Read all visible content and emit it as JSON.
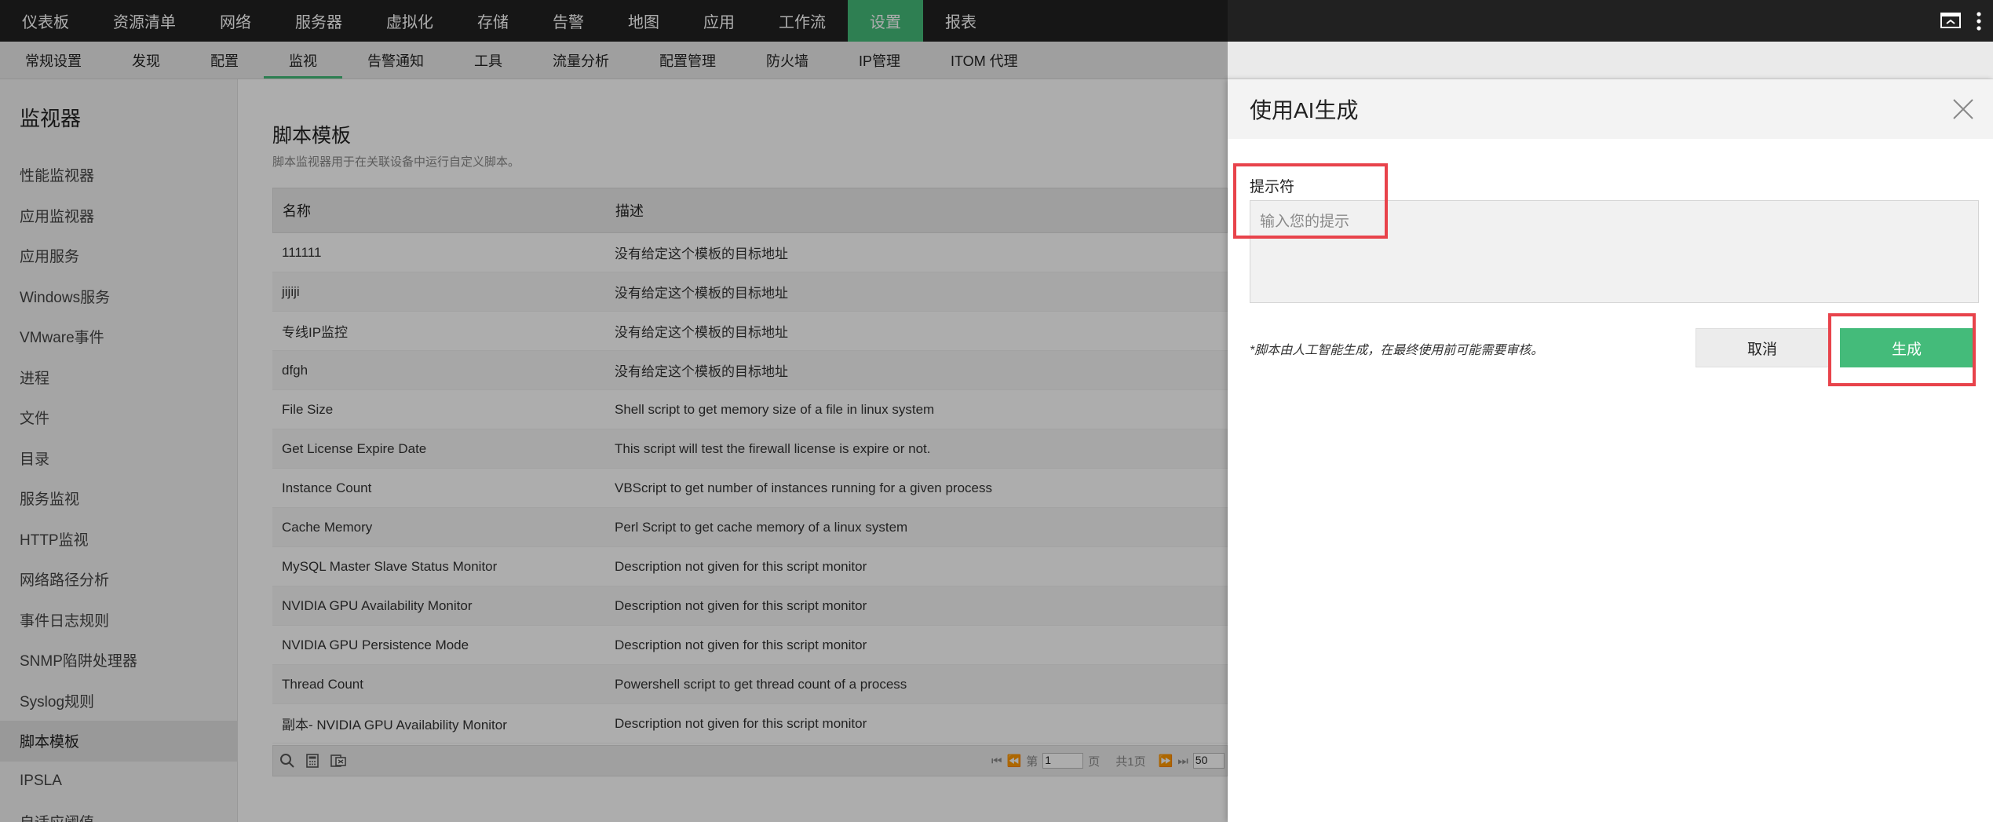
{
  "topnav": {
    "items": [
      "仪表板",
      "资源清单",
      "网络",
      "服务器",
      "虚拟化",
      "存储",
      "告警",
      "地图",
      "应用",
      "工作流",
      "设置",
      "报表"
    ],
    "active": "设置",
    "icons": [
      "monitor-icon",
      "more-vertical-icon"
    ]
  },
  "subnav": {
    "items": [
      "常规设置",
      "发现",
      "配置",
      "监视",
      "告警通知",
      "工具",
      "流量分析",
      "配置管理",
      "防火墙",
      "IP管理",
      "ITOM 代理"
    ],
    "active": "监视"
  },
  "sidebar": {
    "title": "监视器",
    "items": [
      "性能监视器",
      "应用监视器",
      "应用服务",
      "Windows服务",
      "VMware事件",
      "进程",
      "文件",
      "目录",
      "服务监视",
      "HTTP监视",
      "网络路径分析",
      "事件日志规则",
      "SNMP陷阱处理器",
      "Syslog规则",
      "脚本模板",
      "IPSLA",
      "自适应阈值"
    ],
    "active": "脚本模板"
  },
  "main": {
    "heading": "脚本模板",
    "subheading": "脚本监视器用于在关联设备中运行自定义脚本。",
    "columns": [
      "名称",
      "描述"
    ],
    "rows": [
      [
        "111111",
        "没有给定这个模板的目标地址"
      ],
      [
        "jijiji",
        "没有给定这个模板的目标地址"
      ],
      [
        "专线IP监控",
        "没有给定这个模板的目标地址"
      ],
      [
        "dfgh",
        "没有给定这个模板的目标地址"
      ],
      [
        "File Size",
        "Shell script to get memory size of a file in linux system"
      ],
      [
        "Get License Expire Date",
        "This script will test the firewall license is expire or not."
      ],
      [
        "Instance Count",
        "VBScript to get number of instances running for a given process"
      ],
      [
        "Cache Memory",
        "Perl Script to get cache memory of a linux system"
      ],
      [
        "MySQL Master Slave Status Monitor",
        "Description not given for this script monitor"
      ],
      [
        "NVIDIA GPU Availability Monitor",
        "Description not given for this script monitor"
      ],
      [
        "NVIDIA GPU Persistence Mode",
        "Description not given for this script monitor"
      ],
      [
        "Thread Count",
        "Powershell script to get thread count of a process"
      ],
      [
        "副本- NVIDIA GPU Availability Monitor",
        "Description not given for this script monitor"
      ]
    ],
    "pager": {
      "page_prefix": "第",
      "page_value": "1",
      "page_suffix": "页",
      "total": "共1页",
      "page_size": "50"
    }
  },
  "panel": {
    "title": "使用AI生成",
    "label": "提示符",
    "placeholder": "输入您的提示",
    "note": "*脚本由人工智能生成，在最终使用前可能需要审核。",
    "cancel": "取消",
    "generate": "生成"
  },
  "colors": {
    "accent": "#44bb7a",
    "topnav_bg": "#212121",
    "highlight": "#e8434b"
  }
}
